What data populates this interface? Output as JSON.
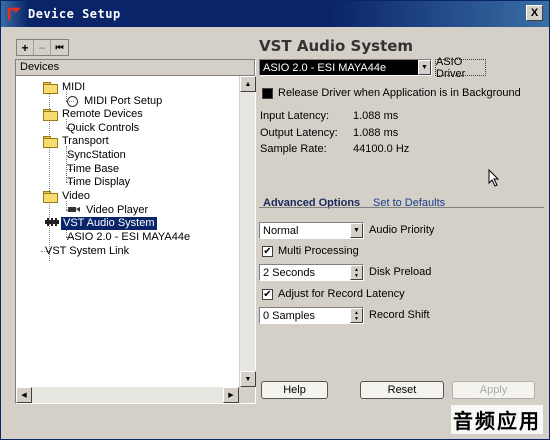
{
  "window": {
    "title": "Device Setup",
    "close_label": "X"
  },
  "toolbar": {
    "add_label": "+",
    "remove_label": "−",
    "reset_label": "⏮"
  },
  "tree": {
    "header": "Devices",
    "items": [
      {
        "label": "MIDI"
      },
      {
        "label": "MIDI Port Setup"
      },
      {
        "label": "Remote Devices"
      },
      {
        "label": "Quick Controls"
      },
      {
        "label": "Transport"
      },
      {
        "label": "SyncStation"
      },
      {
        "label": "Time Base"
      },
      {
        "label": "Time Display"
      },
      {
        "label": "Video"
      },
      {
        "label": "Video Player"
      },
      {
        "label": "VST Audio System"
      },
      {
        "label": "ASIO 2.0 - ESI MAYA44e"
      },
      {
        "label": "VST System Link"
      }
    ]
  },
  "panel": {
    "title": "VST Audio System",
    "driver_value": "ASIO 2.0 - ESI MAYA44e",
    "driver_button": "ASIO Driver",
    "release_driver_label": "Release Driver when Application is in Background",
    "release_driver_checked": false,
    "input_latency_label": "Input Latency:",
    "input_latency_value": "1.088 ms",
    "output_latency_label": "Output Latency:",
    "output_latency_value": "1.088 ms",
    "sample_rate_label": "Sample Rate:",
    "sample_rate_value": "44100.0 Hz",
    "advanced_options": "Advanced Options",
    "set_to_defaults": "Set to Defaults",
    "audio_priority_value": "Normal",
    "audio_priority_label": "Audio Priority",
    "multi_processing_label": "Multi Processing",
    "multi_processing_checked": true,
    "disk_preload_value": "2 Seconds",
    "disk_preload_label": "Disk Preload",
    "adjust_latency_label": "Adjust for Record Latency",
    "adjust_latency_checked": true,
    "record_shift_value": "0 Samples",
    "record_shift_label": "Record Shift",
    "help_label": "Help",
    "reset_label": "Reset",
    "apply_label": "Apply"
  },
  "watermark": "音频应用",
  "colors": {
    "title_bar": "#0a246a",
    "selection": "#0a246a",
    "window_bg": "#d4d0c8",
    "link": "#1a3e8a"
  }
}
